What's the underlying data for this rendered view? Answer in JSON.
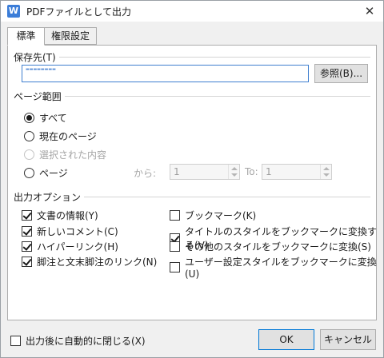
{
  "window": {
    "title": "PDFファイルとして出力",
    "app_icon_letter": "W",
    "close_glyph": "✕"
  },
  "tabs": [
    {
      "label": "標準",
      "active": true
    },
    {
      "label": "権限設定",
      "active": false
    }
  ],
  "save_to": {
    "group_label": "保存先(T)",
    "path_value": "▬▬▬▬▬▬▬▬",
    "browse_label": "参照(B)..."
  },
  "page_range": {
    "group_label": "ページ範囲",
    "options": [
      {
        "label": "すべて",
        "checked": true,
        "disabled": false
      },
      {
        "label": "現在のページ",
        "checked": false,
        "disabled": false
      },
      {
        "label": "選択された内容",
        "checked": false,
        "disabled": true
      },
      {
        "label": "ページ",
        "checked": false,
        "disabled": false
      }
    ],
    "from_label": "から:",
    "from_value": "1",
    "to_label": "To:",
    "to_value": "1"
  },
  "output_options": {
    "group_label": "出力オプション",
    "left": [
      {
        "label": "文書の情報(Y)",
        "checked": true
      },
      {
        "label": "新しいコメント(C)",
        "checked": true
      },
      {
        "label": "ハイパーリンク(H)",
        "checked": true
      },
      {
        "label": "脚注と文末脚注のリンク(N)",
        "checked": true
      }
    ],
    "right": [
      {
        "label": "ブックマーク(K)",
        "checked": false
      },
      {
        "label": "タイトルのスタイルをブックマークに変換する(V)",
        "checked": true
      },
      {
        "label": "その他のスタイルをブックマークに変換(S)",
        "checked": false
      },
      {
        "label": "ユーザー設定スタイルをブックマークに変換(U)",
        "checked": false
      }
    ]
  },
  "footer": {
    "close_after_label": "出力後に自動的に閉じる(X)",
    "close_after_checked": false,
    "ok_label": "OK",
    "cancel_label": "キャンセル"
  },
  "colors": {
    "accent": "#0078d7",
    "path_border": "#3f7fcf",
    "icon": "#3b7dd8"
  }
}
